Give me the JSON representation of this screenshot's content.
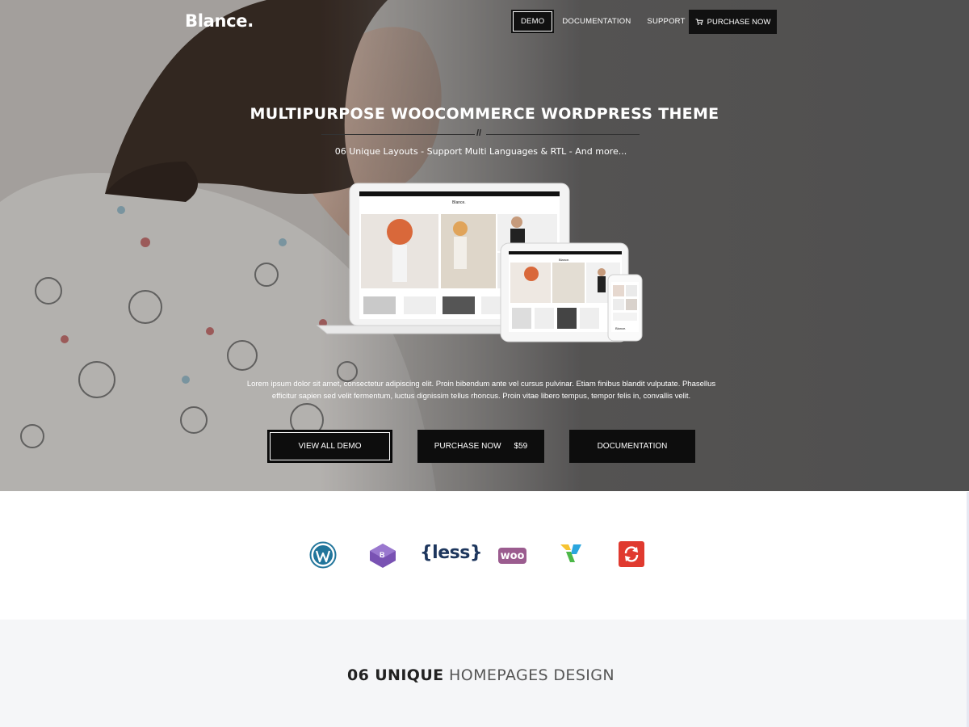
{
  "header": {
    "logo": "Blance.",
    "nav": [
      {
        "label": "DEMO",
        "active": true
      },
      {
        "label": "DOCUMENTATION",
        "active": false
      },
      {
        "label": "SUPPORT",
        "active": false
      }
    ],
    "purchase_label": "PURCHASE NOW",
    "purchase_icon": "cart-icon"
  },
  "hero": {
    "title": "MULTIPURPOSE WOOCOMMERCE WORDPRESS THEME",
    "divider_mark": "//",
    "subtitle": "06 Unique Layouts - Support Multi Languages & RTL - And more...",
    "description_line1": "Lorem ipsum dolor sit amet, consectetur adipiscing elit. Proin bibendum ante vel cursus pulvinar. Etiam finibus blandit vulputate. Phasellus",
    "description_line2": "efficitur sapien sed velit fermentum, luctus dignissim tellus rhoncus. Proin vitae libero tempus, tempor felis in, convallis velit.",
    "buttons": {
      "view_all": "VIEW ALL DEMO",
      "purchase": "PURCHASE NOW",
      "price": "$59",
      "documentation": "DOCUMENTATION"
    },
    "mockup": {
      "laptop_logo": "Blance.",
      "tablet_logo": "Blance.",
      "phone_text": "Blance."
    }
  },
  "tech_icons": [
    {
      "name": "wordpress-icon",
      "color": "#21759b"
    },
    {
      "name": "bootstrap-icon",
      "color": "#7952b3"
    },
    {
      "name": "less-icon",
      "label": "{less}",
      "color": "#1d365d"
    },
    {
      "name": "woocommerce-icon",
      "label": "woo",
      "color": "#9b5c8f"
    },
    {
      "name": "visual-composer-icon",
      "color": "#2ba6de"
    },
    {
      "name": "updates-icon",
      "color": "#e03a2f"
    }
  ],
  "homepages": {
    "title_bold": "06 UNIQUE",
    "title_light": "HOMEPAGES DESIGN"
  },
  "colors": {
    "button_bg": "#0d0d0d",
    "section_bg": "#f5f6f8"
  }
}
